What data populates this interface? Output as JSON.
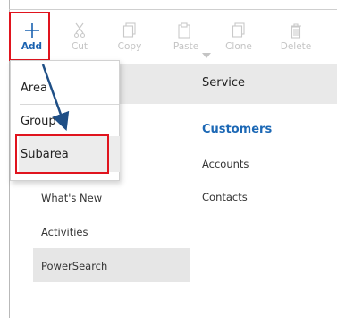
{
  "toolbar": {
    "add_label": "Add",
    "cut_label": "Cut",
    "copy_label": "Copy",
    "paste_label": "Paste",
    "clone_label": "Clone",
    "delete_label": "Delete"
  },
  "add_menu": {
    "items": [
      "Area",
      "Group",
      "Subarea"
    ]
  },
  "area": {
    "title": "Service"
  },
  "group": {
    "title": "Customers",
    "subareas": [
      "Accounts",
      "Contacts"
    ]
  },
  "left_list": {
    "items": [
      "What's New",
      "Activities",
      "PowerSearch"
    ]
  },
  "colors": {
    "highlight_red": "#e0141e",
    "accent_blue": "#1c68b5",
    "arrow_blue": "#1f4f86"
  }
}
